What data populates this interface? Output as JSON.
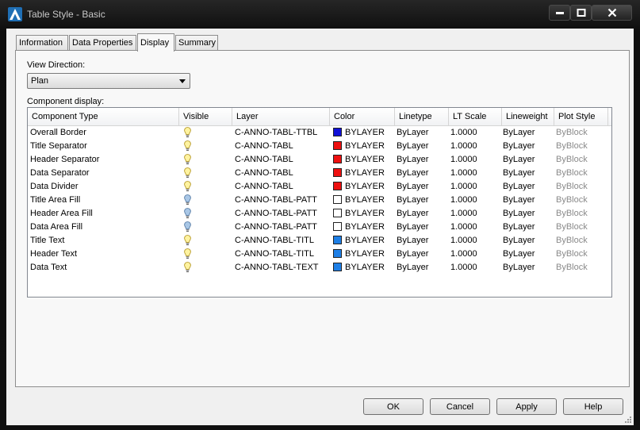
{
  "window": {
    "title": "Table Style - Basic"
  },
  "tabs": [
    {
      "label": "Information"
    },
    {
      "label": "Data Properties"
    },
    {
      "label": "Display"
    },
    {
      "label": "Summary"
    }
  ],
  "view_direction": {
    "label": "View Direction:",
    "value": "Plan"
  },
  "component_display": {
    "label": "Component display:",
    "columns": [
      "Component Type",
      "Visible",
      "Layer",
      "Color",
      "Linetype",
      "LT Scale",
      "Lineweight",
      "Plot Style"
    ],
    "rows": [
      {
        "type": "Overall Border",
        "visible": "on",
        "layer": "C-ANNO-TABL-TTBL",
        "color_hex": "#1010d8",
        "color": "BYLAYER",
        "linetype": "ByLayer",
        "lt_scale": "1.0000",
        "lineweight": "ByLayer",
        "plot_style": "ByBlock"
      },
      {
        "type": "Title Separator",
        "visible": "on",
        "layer": "C-ANNO-TABL",
        "color_hex": "#ee1010",
        "color": "BYLAYER",
        "linetype": "ByLayer",
        "lt_scale": "1.0000",
        "lineweight": "ByLayer",
        "plot_style": "ByBlock"
      },
      {
        "type": "Header Separator",
        "visible": "on",
        "layer": "C-ANNO-TABL",
        "color_hex": "#ee1010",
        "color": "BYLAYER",
        "linetype": "ByLayer",
        "lt_scale": "1.0000",
        "lineweight": "ByLayer",
        "plot_style": "ByBlock"
      },
      {
        "type": "Data Separator",
        "visible": "on",
        "layer": "C-ANNO-TABL",
        "color_hex": "#ee1010",
        "color": "BYLAYER",
        "linetype": "ByLayer",
        "lt_scale": "1.0000",
        "lineweight": "ByLayer",
        "plot_style": "ByBlock"
      },
      {
        "type": "Data Divider",
        "visible": "on",
        "layer": "C-ANNO-TABL",
        "color_hex": "#ee1010",
        "color": "BYLAYER",
        "linetype": "ByLayer",
        "lt_scale": "1.0000",
        "lineweight": "ByLayer",
        "plot_style": "ByBlock"
      },
      {
        "type": "Title Area Fill",
        "visible": "off",
        "layer": "C-ANNO-TABL-PATT",
        "color_hex": "#ffffff",
        "color": "BYLAYER",
        "linetype": "ByLayer",
        "lt_scale": "1.0000",
        "lineweight": "ByLayer",
        "plot_style": "ByBlock"
      },
      {
        "type": "Header Area Fill",
        "visible": "off",
        "layer": "C-ANNO-TABL-PATT",
        "color_hex": "#ffffff",
        "color": "BYLAYER",
        "linetype": "ByLayer",
        "lt_scale": "1.0000",
        "lineweight": "ByLayer",
        "plot_style": "ByBlock"
      },
      {
        "type": "Data Area Fill",
        "visible": "off",
        "layer": "C-ANNO-TABL-PATT",
        "color_hex": "#ffffff",
        "color": "BYLAYER",
        "linetype": "ByLayer",
        "lt_scale": "1.0000",
        "lineweight": "ByLayer",
        "plot_style": "ByBlock"
      },
      {
        "type": "Title Text",
        "visible": "on",
        "layer": "C-ANNO-TABL-TITL",
        "color_hex": "#1e7fe6",
        "color": "BYLAYER",
        "linetype": "ByLayer",
        "lt_scale": "1.0000",
        "lineweight": "ByLayer",
        "plot_style": "ByBlock"
      },
      {
        "type": "Header Text",
        "visible": "on",
        "layer": "C-ANNO-TABL-TITL",
        "color_hex": "#1e7fe6",
        "color": "BYLAYER",
        "linetype": "ByLayer",
        "lt_scale": "1.0000",
        "lineweight": "ByLayer",
        "plot_style": "ByBlock"
      },
      {
        "type": "Data Text",
        "visible": "on",
        "layer": "C-ANNO-TABL-TEXT",
        "color_hex": "#1e7fe6",
        "color": "BYLAYER",
        "linetype": "ByLayer",
        "lt_scale": "1.0000",
        "lineweight": "ByLayer",
        "plot_style": "ByBlock"
      }
    ]
  },
  "buttons": {
    "ok": "OK",
    "cancel": "Cancel",
    "apply": "Apply",
    "help": "Help"
  },
  "icons": {
    "app": "autocad-logo-icon",
    "visible_on": "lightbulb-on-icon",
    "visible_off": "lightbulb-off-icon"
  }
}
